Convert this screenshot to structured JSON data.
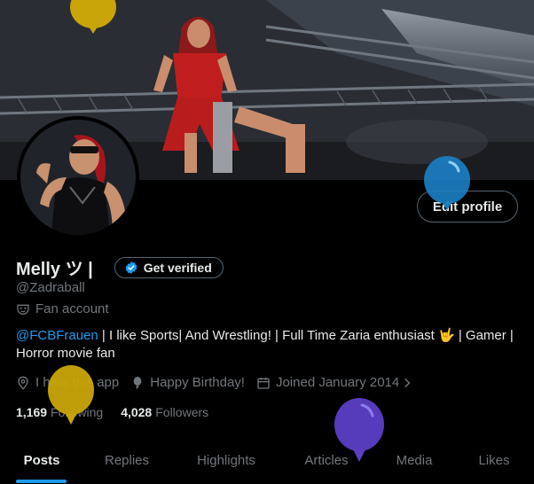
{
  "profile": {
    "display_name": "Melly ツ |",
    "handle": "@Zadraball",
    "category": "Fan account",
    "bio_mention": "@FCBFrauen",
    "bio_text": " | I like Sports| And Wrestling! | Full Time Zaria enthusiast 🤟 | Gamer | Horror movie fan",
    "location": "I hate this app",
    "birthday": "Happy Birthday!",
    "joined": "Joined January 2014",
    "following_count": "1,169",
    "following_label": "Following",
    "followers_count": "4,028",
    "followers_label": "Followers"
  },
  "buttons": {
    "edit_profile": "Edit profile",
    "get_verified": "Get verified"
  },
  "tabs": [
    "Posts",
    "Replies",
    "Highlights",
    "Articles",
    "Media",
    "Likes"
  ],
  "active_tab": "Posts",
  "colors": {
    "accent": "#1d9bf0",
    "text_primary": "#e7e9ea",
    "text_secondary": "#71767b",
    "border": "#536471",
    "balloon_yellow": "#c9a50a",
    "balloon_blue": "#1d7fc4",
    "balloon_purple": "#5b3fc4"
  },
  "icons": {
    "verified": "verified-badge-icon",
    "category": "mask-icon",
    "location": "location-pin-icon",
    "birthday": "balloon-icon",
    "joined": "calendar-icon",
    "chevron": "chevron-right-icon"
  }
}
